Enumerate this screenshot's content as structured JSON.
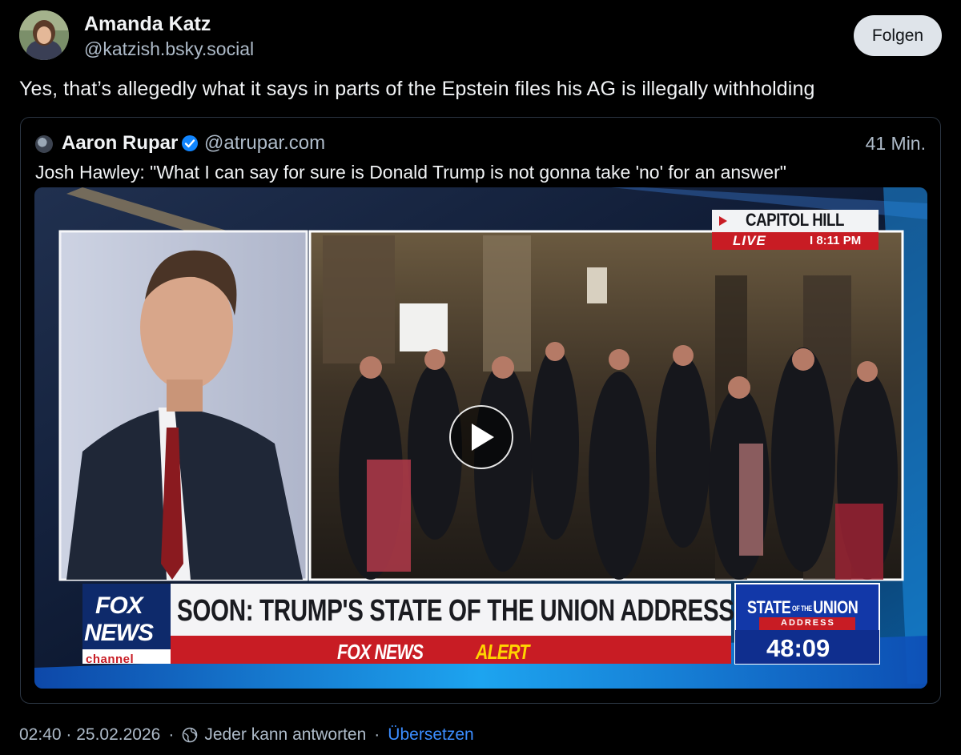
{
  "post": {
    "author_name": "Amanda Katz",
    "author_handle": "@katzish.bsky.social",
    "follow_label": "Folgen",
    "text": "Yes, that’s allegedly what it says in parts of the Epstein files his AG is illegally withholding"
  },
  "quote": {
    "author_name": "Aaron Rupar",
    "author_handle": "@atrupar.com",
    "time": "41 Min.",
    "text": "Josh Hawley: \"What I can say for sure is Donald Trump is not gonna take 'no' for an answer\""
  },
  "video": {
    "location": "CAPITOL HILL",
    "live_label": "LIVE",
    "live_time": "I 8:11 PM",
    "headline": "SOON: TRUMP'S STATE OF THE UNION ADDRESS",
    "alert_brand": "FOX NEWS",
    "alert_word": "ALERT",
    "logo_fox": "FOX",
    "logo_news": "NEWS",
    "logo_channel": "channel",
    "sotu_title": "STATE",
    "sotu_of_the": "OF THE",
    "sotu_union": "UNION",
    "sotu_sub": "ADDRESS",
    "countdown": "48:09",
    "play_icon": "play-icon"
  },
  "footer": {
    "timestamp": "02:40 · 25.02.2026",
    "reply_setting": "Jeder kann antworten",
    "dot": "·",
    "translate": "Übersetzen",
    "reply_icon": "globe-reply-icon"
  },
  "colors": {
    "background": "#000000",
    "text": "#f1f3f5",
    "muted": "#aebbc9",
    "link": "#3b8dff",
    "verified": "#1185fe",
    "fox_red": "#c81c24"
  }
}
